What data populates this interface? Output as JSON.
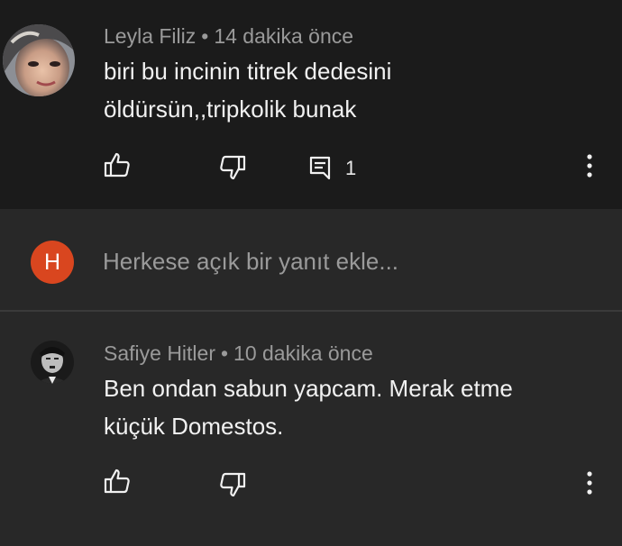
{
  "comments": [
    {
      "author": "Leyla Filiz",
      "separator": "•",
      "time": "14 dakika önce",
      "lines": [
        "biri bu incinin titrek dedesini",
        "öldürsün,,tripkolik bunak"
      ],
      "reply_count": "1"
    },
    {
      "author": "Safiye Hitler",
      "separator": "•",
      "time": "10 dakika önce",
      "lines": [
        "Ben ondan sabun yapcam. Merak etme",
        "küçük Domestos."
      ]
    }
  ],
  "reply_box": {
    "avatar_letter": "H",
    "placeholder": "Herkese açık bir yanıt ekle..."
  },
  "icons": {
    "like": "thumbs-up-icon",
    "dislike": "thumbs-down-icon",
    "reply": "comment-icon",
    "more": "more-vertical-icon"
  },
  "colors": {
    "reply_avatar": "#d9461f",
    "top_background": "#1b1b1b",
    "page_background": "#282828"
  }
}
